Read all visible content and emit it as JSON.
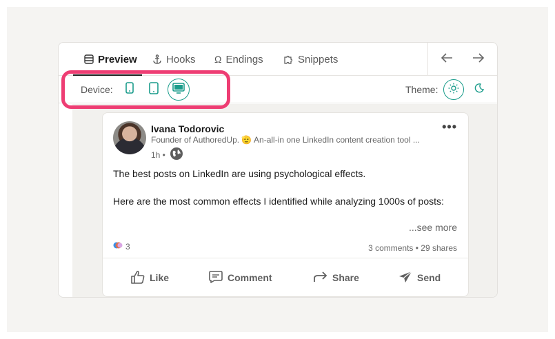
{
  "tabs": [
    {
      "label": "Preview",
      "icon": "layout-icon",
      "active": true
    },
    {
      "label": "Hooks",
      "icon": "anchor-icon",
      "active": false
    },
    {
      "label": "Endings",
      "icon": "omega-icon",
      "active": false
    },
    {
      "label": "Snippets",
      "icon": "puzzle-icon",
      "active": false
    }
  ],
  "nav": {
    "back": "arrow-left-icon",
    "forward": "arrow-right-icon"
  },
  "device": {
    "label": "Device:",
    "options": [
      "mobile",
      "tablet",
      "desktop"
    ],
    "selected": "desktop"
  },
  "theme": {
    "label": "Theme:",
    "options": [
      "light",
      "dark"
    ],
    "selected": "light"
  },
  "post": {
    "author": "Ivana Todorovic",
    "subtitle": "Founder of AuthoredUp. 🫡 An-all-in one LinkedIn content creation tool ...",
    "time": "1h •",
    "line1": "The best posts on LinkedIn are using psychological effects.",
    "line2": "Here are the most common effects I identified while analyzing 1000s of posts:",
    "see_more": "...see more",
    "reaction_count": "3",
    "counts": "3 comments • 29 shares",
    "actions": [
      "Like",
      "Comment",
      "Share",
      "Send"
    ]
  },
  "colors": {
    "accent": "#1a9c8b",
    "highlight": "#ee3d73"
  }
}
